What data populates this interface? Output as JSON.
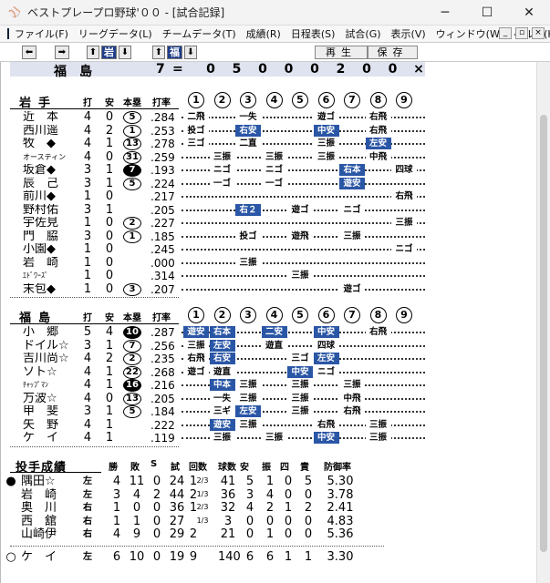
{
  "window": {
    "title": "ベストプレープロ野球'００ - [試合記録]",
    "controls": [
      "─",
      "☐",
      "✕"
    ]
  },
  "menu": [
    "ファイル(F)",
    "リーグデータ(L)",
    "チームデータ(T)",
    "成績(R)",
    "日程表(S)",
    "試合(G)",
    "表示(V)",
    "ウィンドウ(W)",
    "ヘルプ(H)"
  ],
  "mdi_controls": [
    "_",
    "▫",
    "×"
  ],
  "toolbar": {
    "prev": "⬅",
    "next": "➡",
    "team1": "岩",
    "team2": "福",
    "up": "⬆",
    "down": "⬇",
    "replay": "再生",
    "save": "保存"
  },
  "scoreline": {
    "team": "福島",
    "runs": "7",
    "eq": "=",
    "innings": [
      "0",
      "5",
      "0",
      "0",
      "0",
      "2",
      "0",
      "0",
      "×"
    ]
  },
  "headers": {
    "ab": "打",
    "hits": "安",
    "hr": "本塁",
    "avg": "打率",
    "innings": [
      "1",
      "2",
      "3",
      "4",
      "5",
      "6",
      "7",
      "8",
      "9"
    ]
  },
  "team1": {
    "name": "岩手",
    "rows": [
      {
        "name": "近　本",
        "ab": "4",
        "h": "0",
        "hr": "5",
        "hrb": false,
        "avg": ".284",
        "cells": [
          {
            "i": 0,
            "t": "二飛"
          },
          {
            "i": 2,
            "t": "一失"
          },
          {
            "i": 5,
            "t": "遊ゴ"
          },
          {
            "i": 7,
            "t": "右飛"
          }
        ]
      },
      {
        "name": "西川遥",
        "ab": "4",
        "h": "2",
        "hr": "1",
        "hrb": false,
        "avg": ".253",
        "cells": [
          {
            "i": 0,
            "t": "投ゴ"
          },
          {
            "i": 2,
            "t": "右安",
            "hit": true
          },
          {
            "i": 5,
            "t": "中安",
            "hit": true
          },
          {
            "i": 7,
            "t": "右飛"
          }
        ]
      },
      {
        "name": "牧　◆",
        "ab": "4",
        "h": "1",
        "hr": "13",
        "hrb": false,
        "avg": ".278",
        "cells": [
          {
            "i": 0,
            "t": "三ゴ"
          },
          {
            "i": 2,
            "t": "二直"
          },
          {
            "i": 5,
            "t": "三振"
          },
          {
            "i": 7,
            "t": "左安",
            "hit": true
          }
        ]
      },
      {
        "name": "オースティン",
        "small": true,
        "ab": "4",
        "h": "0",
        "hr": "31",
        "hrb": false,
        "avg": ".259",
        "cells": [
          {
            "i": 1,
            "t": "三振"
          },
          {
            "i": 3,
            "t": "三振"
          },
          {
            "i": 5,
            "t": "三振"
          },
          {
            "i": 7,
            "t": "中飛"
          }
        ]
      },
      {
        "name": "坂倉◆",
        "ab": "3",
        "h": "1",
        "hr": "7",
        "hrb": true,
        "avg": ".193",
        "cells": [
          {
            "i": 1,
            "t": "ニゴ"
          },
          {
            "i": 3,
            "t": "ニゴ"
          },
          {
            "i": 6,
            "t": "右本",
            "hit": true
          },
          {
            "i": 8,
            "t": "四球"
          }
        ]
      },
      {
        "name": "辰　己",
        "ab": "3",
        "h": "1",
        "hr": "5",
        "hrb": false,
        "avg": ".224",
        "cells": [
          {
            "i": 1,
            "t": "一ゴ"
          },
          {
            "i": 3,
            "t": "一ゴ"
          },
          {
            "i": 6,
            "t": "遊安",
            "hit": true
          }
        ]
      },
      {
        "name": "前川◆",
        "ab": "1",
        "h": "0",
        "hr": "",
        "hrb": false,
        "avg": ".217",
        "cells": [
          {
            "i": 8,
            "t": "右飛"
          }
        ]
      },
      {
        "name": "野村佑",
        "ab": "3",
        "h": "1",
        "hr": "",
        "hrb": false,
        "avg": ".205",
        "cells": [
          {
            "i": 2,
            "t": "右２",
            "hit": true
          },
          {
            "i": 4,
            "t": "遊ゴ"
          },
          {
            "i": 6,
            "t": "ニゴ"
          }
        ]
      },
      {
        "name": "宇佐見",
        "ab": "1",
        "h": "0",
        "hr": "2",
        "hrb": false,
        "avg": ".227",
        "cells": [
          {
            "i": 8,
            "t": "三振"
          }
        ]
      },
      {
        "name": "門　脇",
        "ab": "3",
        "h": "0",
        "hr": "1",
        "hrb": false,
        "avg": ".185",
        "cells": [
          {
            "i": 2,
            "t": "投ゴ"
          },
          {
            "i": 4,
            "t": "遊飛"
          },
          {
            "i": 6,
            "t": "三振"
          }
        ]
      },
      {
        "name": "小園◆",
        "ab": "1",
        "h": "0",
        "hr": "",
        "hrb": false,
        "avg": ".245",
        "cells": [
          {
            "i": 8,
            "t": "ニゴ"
          }
        ]
      },
      {
        "name": "岩　崎",
        "ab": "1",
        "h": "0",
        "hr": "",
        "hrb": false,
        "avg": ".000",
        "cells": [
          {
            "i": 2,
            "t": "三振"
          }
        ]
      },
      {
        "name": "ｴﾄﾞﾜｰｽﾞ",
        "small": true,
        "ab": "1",
        "h": "0",
        "hr": "",
        "hrb": false,
        "avg": ".314",
        "cells": [
          {
            "i": 4,
            "t": "三振"
          }
        ]
      },
      {
        "name": "末包◆",
        "ab": "1",
        "h": "0",
        "hr": "3",
        "hrb": false,
        "avg": ".207",
        "cells": [
          {
            "i": 6,
            "t": "遊ゴ"
          }
        ]
      }
    ]
  },
  "team2": {
    "name": "福島",
    "rows": [
      {
        "name": "小　郷",
        "ab": "5",
        "h": "4",
        "hr": "10",
        "hrb": true,
        "avg": ".287",
        "cells": [
          {
            "i": 0,
            "t": "遊安",
            "hit": true
          },
          {
            "i": 1,
            "t": "右本",
            "hit": true
          },
          {
            "i": 3,
            "t": "二安",
            "hit": true
          },
          {
            "i": 5,
            "t": "中安",
            "hit": true
          },
          {
            "i": 7,
            "t": "右飛"
          }
        ]
      },
      {
        "name": "ドイル☆",
        "ab": "3",
        "h": "1",
        "hr": "7",
        "hrb": false,
        "avg": ".256",
        "cells": [
          {
            "i": 0,
            "t": "三振"
          },
          {
            "i": 1,
            "t": "左安",
            "hit": true
          },
          {
            "i": 3,
            "t": "遊直"
          },
          {
            "i": 5,
            "t": "四球"
          }
        ]
      },
      {
        "name": "吉川尚☆",
        "ab": "4",
        "h": "2",
        "hr": "2",
        "hrb": false,
        "avg": ".235",
        "cells": [
          {
            "i": 0,
            "t": "右飛"
          },
          {
            "i": 1,
            "t": "右安",
            "hit": true
          },
          {
            "i": 4,
            "t": "三ゴ"
          },
          {
            "i": 5,
            "t": "左安",
            "hit": true
          }
        ]
      },
      {
        "name": "ソト☆",
        "ab": "4",
        "h": "1",
        "hr": "22",
        "hrb": false,
        "avg": ".268",
        "cells": [
          {
            "i": 0,
            "t": "遊ゴ"
          },
          {
            "i": 1,
            "t": "遊直"
          },
          {
            "i": 4,
            "t": "中安",
            "hit": true
          },
          {
            "i": 5,
            "t": "ニゴ"
          }
        ]
      },
      {
        "name": "ﾁｬｯﾌﾟﾏﾝ",
        "small": true,
        "ab": "4",
        "h": "1",
        "hr": "16",
        "hrb": true,
        "avg": ".216",
        "cells": [
          {
            "i": 1,
            "t": "中本",
            "hit": true
          },
          {
            "i": 2,
            "t": "三振"
          },
          {
            "i": 4,
            "t": "三振"
          },
          {
            "i": 6,
            "t": "三振"
          }
        ]
      },
      {
        "name": "万波☆",
        "ab": "4",
        "h": "0",
        "hr": "13",
        "hrb": false,
        "avg": ".205",
        "cells": [
          {
            "i": 1,
            "t": "一失"
          },
          {
            "i": 2,
            "t": "三振"
          },
          {
            "i": 4,
            "t": "三振"
          },
          {
            "i": 6,
            "t": "中飛"
          }
        ]
      },
      {
        "name": "甲　斐",
        "ab": "3",
        "h": "1",
        "hr": "5",
        "hrb": false,
        "avg": ".184",
        "cells": [
          {
            "i": 1,
            "t": "三ギ"
          },
          {
            "i": 2,
            "t": "左安",
            "hit": true
          },
          {
            "i": 4,
            "t": "三振"
          },
          {
            "i": 6,
            "t": "右飛"
          }
        ]
      },
      {
        "name": "矢　野",
        "ab": "4",
        "h": "1",
        "hr": "",
        "hrb": false,
        "avg": ".222",
        "cells": [
          {
            "i": 1,
            "t": "遊安",
            "hit": true
          },
          {
            "i": 2,
            "t": "三振"
          },
          {
            "i": 5,
            "t": "右飛"
          },
          {
            "i": 7,
            "t": "三振"
          }
        ]
      },
      {
        "name": "ケ　イ",
        "ab": "4",
        "h": "1",
        "hr": "",
        "hrb": false,
        "avg": ".119",
        "cells": [
          {
            "i": 1,
            "t": "三振"
          },
          {
            "i": 3,
            "t": "三振"
          },
          {
            "i": 5,
            "t": "中安",
            "hit": true
          },
          {
            "i": 7,
            "t": "三振"
          }
        ]
      }
    ]
  },
  "pitching": {
    "title": "投手成績",
    "headers": [
      "勝",
      "敗",
      "S",
      "試",
      "回数",
      "球数",
      "安",
      "振",
      "四",
      "責",
      "防御率"
    ],
    "rows": [
      {
        "mark": "●",
        "name": "隅田☆",
        "hand": "左",
        "w": "4",
        "l": "11",
        "s": "0",
        "g": "24",
        "ip": "1",
        "ipf": "2/3",
        "np": "41",
        "h": "5",
        "k": "1",
        "bb": "0",
        "er": "5",
        "era": "5.30"
      },
      {
        "mark": "",
        "name": "岩　崎",
        "hand": "左",
        "w": "3",
        "l": "4",
        "s": "2",
        "g": "44",
        "ip": "2",
        "ipf": "1/3",
        "np": "36",
        "h": "3",
        "k": "4",
        "bb": "0",
        "er": "0",
        "era": "3.78"
      },
      {
        "mark": "",
        "name": "奥　川",
        "hand": "右",
        "w": "1",
        "l": "0",
        "s": "0",
        "g": "36",
        "ip": "1",
        "ipf": "2/3",
        "np": "32",
        "h": "4",
        "k": "2",
        "bb": "1",
        "er": "2",
        "era": "2.41"
      },
      {
        "mark": "",
        "name": "西　舘",
        "hand": "右",
        "w": "1",
        "l": "1",
        "s": "0",
        "g": "27",
        "ip": "",
        "ipf": "1/3",
        "np": "3",
        "h": "0",
        "k": "0",
        "bb": "0",
        "er": "0",
        "era": "4.83"
      },
      {
        "mark": "",
        "name": "山崎伊",
        "hand": "右",
        "w": "4",
        "l": "9",
        "s": "0",
        "g": "29",
        "ip": "2",
        "ipf": "",
        "np": "21",
        "h": "0",
        "k": "1",
        "bb": "0",
        "er": "0",
        "era": "5.36"
      }
    ],
    "winner": {
      "mark": "○",
      "name": "ケ　イ",
      "hand": "左",
      "w": "6",
      "l": "10",
      "s": "0",
      "g": "19",
      "ip": "9",
      "ipf": "",
      "np": "140",
      "h": "6",
      "k": "6",
      "bb": "1",
      "er": "1",
      "era": "3.30"
    }
  }
}
